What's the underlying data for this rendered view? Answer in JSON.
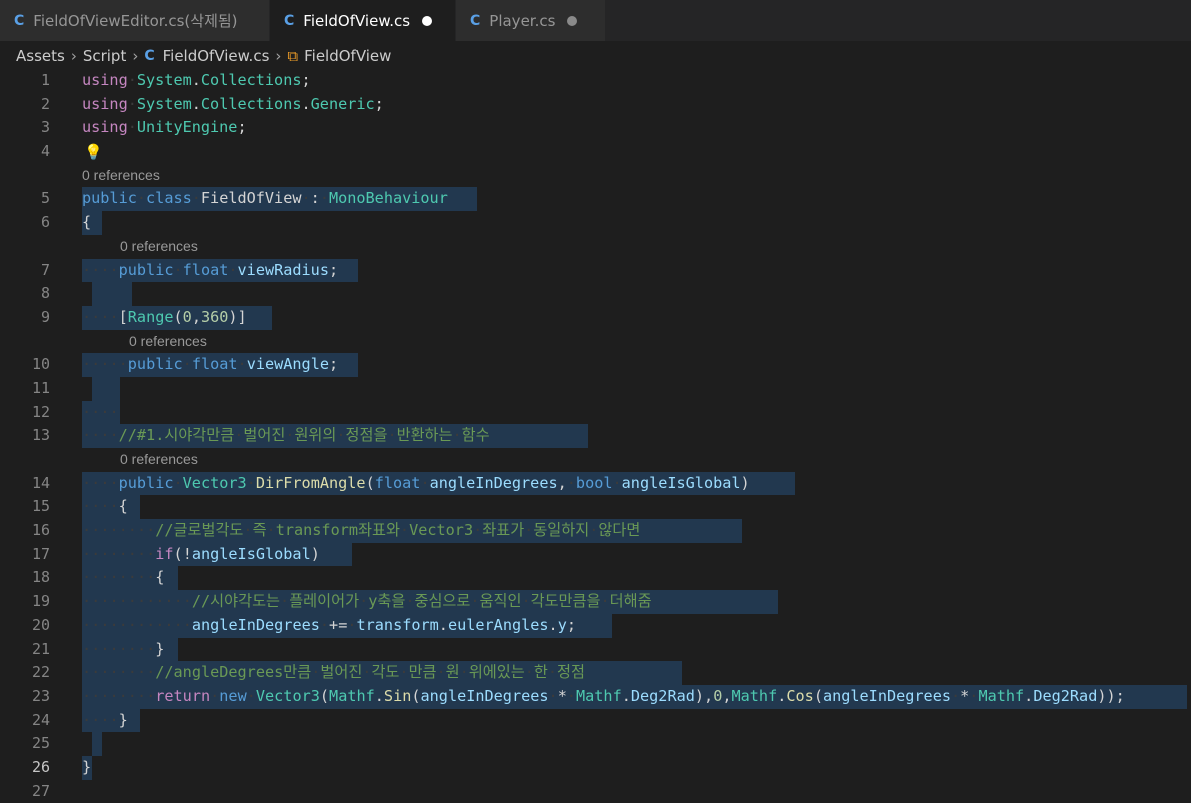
{
  "tabs": [
    {
      "label": "FieldOfViewEditor.cs(삭제됨)",
      "icon": "csharp-icon",
      "modified": false
    },
    {
      "label": "FieldOfView.cs",
      "icon": "csharp-icon",
      "modified": true
    },
    {
      "label": "Player.cs",
      "icon": "csharp-icon",
      "modified": true
    }
  ],
  "breadcrumb": {
    "items": [
      "Assets",
      "Script",
      "FieldOfView.cs",
      "FieldOfView"
    ]
  },
  "code_lens": "0 references",
  "lines": [
    {
      "n": "1",
      "text": "using System.Collections;"
    },
    {
      "n": "2",
      "text": "using System.Collections.Generic;"
    },
    {
      "n": "3",
      "text": "using UnityEngine;"
    },
    {
      "n": "4",
      "text": ""
    },
    {
      "n": "5",
      "text": "public class FieldOfView : MonoBehaviour"
    },
    {
      "n": "6",
      "text": "{"
    },
    {
      "n": "7",
      "text": "    public float viewRadius;"
    },
    {
      "n": "8",
      "text": ""
    },
    {
      "n": "9",
      "text": "    [Range(0,360)]"
    },
    {
      "n": "10",
      "text": "     public float viewAngle;"
    },
    {
      "n": "11",
      "text": ""
    },
    {
      "n": "12",
      "text": "    "
    },
    {
      "n": "13",
      "text": "    //#1.시야각만큼 벌어진 원위의 정점을 반환하는 함수"
    },
    {
      "n": "14",
      "text": "    public Vector3 DirFromAngle(float angleInDegrees, bool angleIsGlobal)"
    },
    {
      "n": "15",
      "text": "    {"
    },
    {
      "n": "16",
      "text": "        //글로벌각도 즉 transform좌표와 Vector3 좌표가 동일하지 않다면"
    },
    {
      "n": "17",
      "text": "        if(!angleIsGlobal)"
    },
    {
      "n": "18",
      "text": "        {"
    },
    {
      "n": "19",
      "text": "            //시야각도는 플레이어가 y축을 중심으로 움직인 각도만큼을 더해줌"
    },
    {
      "n": "20",
      "text": "            angleInDegrees += transform.eulerAngles.y;"
    },
    {
      "n": "21",
      "text": "        }"
    },
    {
      "n": "22",
      "text": "        //angleDegrees만큼 벌어진 각도 만큼 원 위에있는 한 정점"
    },
    {
      "n": "23",
      "text": "        return new Vector3(Mathf.Sin(angleInDegrees * Mathf.Deg2Rad),0,Mathf.Cos(angleInDegrees * Mathf.Deg2Rad));"
    },
    {
      "n": "24",
      "text": "    }"
    },
    {
      "n": "25",
      "text": ""
    },
    {
      "n": "26",
      "text": "}"
    },
    {
      "n": "27",
      "text": ""
    }
  ],
  "colors": {
    "keyword_control": "#c586c0",
    "keyword": "#569cd6",
    "type": "#4ec9b0",
    "function": "#dcdcaa",
    "variable": "#9cdcfe",
    "number": "#b5cea8",
    "comment": "#6a9955",
    "selection": "#264f78"
  }
}
